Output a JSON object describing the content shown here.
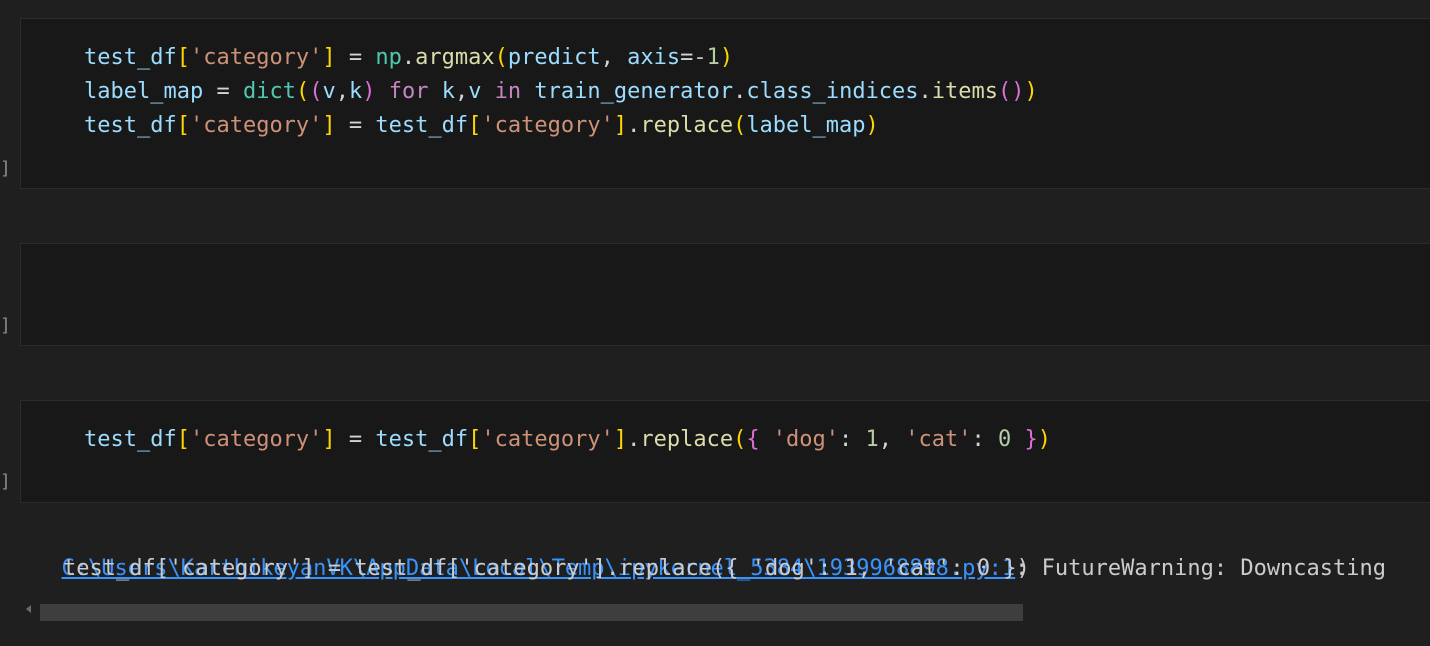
{
  "cells": [
    {
      "bracket": "]",
      "lines": [
        [
          {
            "t": "test_df",
            "c": "v"
          },
          {
            "t": "[",
            "c": "b1"
          },
          {
            "t": "'category'",
            "c": "s"
          },
          {
            "t": "]",
            "c": "b1"
          },
          {
            "t": " = ",
            "c": "op"
          },
          {
            "t": "np",
            "c": "cls"
          },
          {
            "t": ".",
            "c": "p"
          },
          {
            "t": "argmax",
            "c": "fn"
          },
          {
            "t": "(",
            "c": "b1"
          },
          {
            "t": "predict",
            "c": "v"
          },
          {
            "t": ", ",
            "c": "p"
          },
          {
            "t": "axis",
            "c": "v"
          },
          {
            "t": "=",
            "c": "op"
          },
          {
            "t": "-1",
            "c": "num"
          },
          {
            "t": ")",
            "c": "b1"
          }
        ],
        [
          {
            "t": "label_map",
            "c": "v"
          },
          {
            "t": " = ",
            "c": "op"
          },
          {
            "t": "dict",
            "c": "cls"
          },
          {
            "t": "(",
            "c": "b1"
          },
          {
            "t": "(",
            "c": "b2"
          },
          {
            "t": "v",
            "c": "v"
          },
          {
            "t": ",",
            "c": "p"
          },
          {
            "t": "k",
            "c": "v"
          },
          {
            "t": ")",
            "c": "b2"
          },
          {
            "t": " for ",
            "c": "kw"
          },
          {
            "t": "k",
            "c": "v"
          },
          {
            "t": ",",
            "c": "p"
          },
          {
            "t": "v",
            "c": "v"
          },
          {
            "t": " in ",
            "c": "kw"
          },
          {
            "t": "train_generator",
            "c": "v"
          },
          {
            "t": ".",
            "c": "p"
          },
          {
            "t": "class_indices",
            "c": "v"
          },
          {
            "t": ".",
            "c": "p"
          },
          {
            "t": "items",
            "c": "fn"
          },
          {
            "t": "(",
            "c": "b2"
          },
          {
            "t": ")",
            "c": "b2"
          },
          {
            "t": ")",
            "c": "b1"
          }
        ],
        [
          {
            "t": "test_df",
            "c": "v"
          },
          {
            "t": "[",
            "c": "b1"
          },
          {
            "t": "'category'",
            "c": "s"
          },
          {
            "t": "]",
            "c": "b1"
          },
          {
            "t": " = ",
            "c": "op"
          },
          {
            "t": "test_df",
            "c": "v"
          },
          {
            "t": "[",
            "c": "b1"
          },
          {
            "t": "'category'",
            "c": "s"
          },
          {
            "t": "]",
            "c": "b1"
          },
          {
            "t": ".",
            "c": "p"
          },
          {
            "t": "replace",
            "c": "fn"
          },
          {
            "t": "(",
            "c": "b1"
          },
          {
            "t": "label_map",
            "c": "v"
          },
          {
            "t": ")",
            "c": "b1"
          }
        ]
      ]
    },
    {
      "bracket": "]",
      "lines": []
    },
    {
      "bracket": "]",
      "lines": [
        [
          {
            "t": "test_df",
            "c": "v"
          },
          {
            "t": "[",
            "c": "b1"
          },
          {
            "t": "'category'",
            "c": "s"
          },
          {
            "t": "]",
            "c": "b1"
          },
          {
            "t": " = ",
            "c": "op"
          },
          {
            "t": "test_df",
            "c": "v"
          },
          {
            "t": "[",
            "c": "b1"
          },
          {
            "t": "'category'",
            "c": "s"
          },
          {
            "t": "]",
            "c": "b1"
          },
          {
            "t": ".",
            "c": "p"
          },
          {
            "t": "replace",
            "c": "fn"
          },
          {
            "t": "(",
            "c": "b1"
          },
          {
            "t": "{",
            "c": "b2"
          },
          {
            "t": " 'dog'",
            "c": "s"
          },
          {
            "t": ": ",
            "c": "p"
          },
          {
            "t": "1",
            "c": "num"
          },
          {
            "t": ", ",
            "c": "p"
          },
          {
            "t": "'cat'",
            "c": "s"
          },
          {
            "t": ": ",
            "c": "p"
          },
          {
            "t": "0",
            "c": "num"
          },
          {
            "t": " ",
            "c": "p"
          },
          {
            "t": "}",
            "c": "b2"
          },
          {
            "t": ")",
            "c": "b1"
          }
        ]
      ]
    }
  ],
  "output": {
    "link": "C:\\Users\\KarthikeyanVK\\AppData\\Local\\Temp\\ipykernel_5384\\1939968898.py:1",
    "warning": ": FutureWarning: Downcasting",
    "line2": "test_df['category'] = test_df['category'].replace({ 'dog': 1, 'cat': 0 })"
  }
}
